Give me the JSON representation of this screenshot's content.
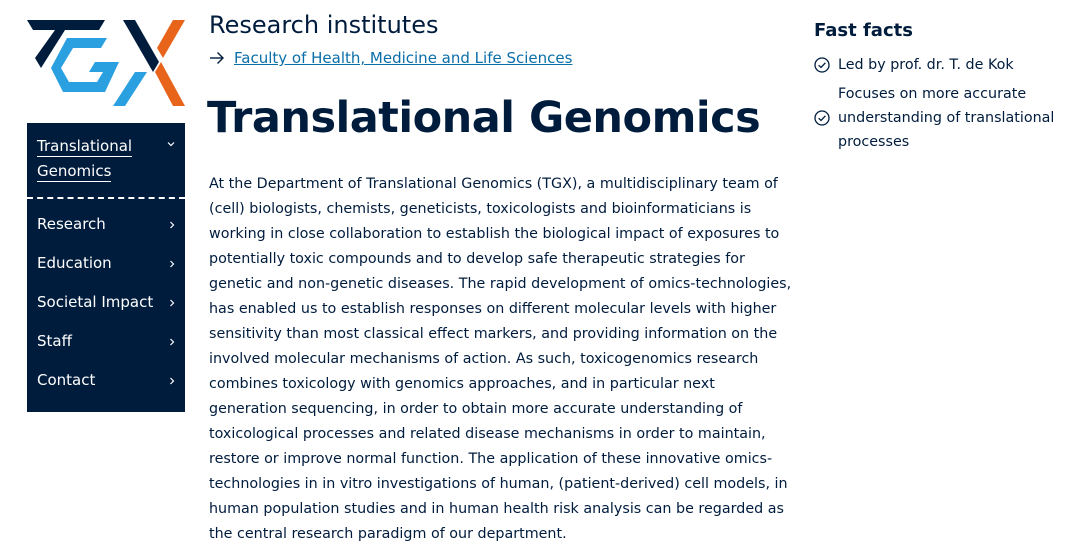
{
  "logo": {
    "name": "TGX"
  },
  "sidebar": {
    "active": {
      "label": "Translational Genomics"
    },
    "items": [
      {
        "label": "Research"
      },
      {
        "label": "Education"
      },
      {
        "label": "Societal Impact"
      },
      {
        "label": "Staff"
      },
      {
        "label": "Contact"
      }
    ]
  },
  "header": {
    "section_title": "Research institutes",
    "faculty_link": "Faculty of Health, Medicine and Life Sciences",
    "page_title": "Translational Genomics"
  },
  "main": {
    "intro": "At the Department of Translational Genomics (TGX), a multidisciplinary team of (cell) biologists, chemists, geneticists, toxicologists and bioinformaticians is working in close collaboration to establish the biological impact of exposures to potentially toxic compounds and to develop safe therapeutic strategies for genetic and non-genetic diseases. The rapid development of omics-technologies, has enabled us to establish responses on different molecular levels with higher sensitivity than most classical effect markers, and providing information on the involved molecular mechanisms of action. As such, toxicogenomics research combines toxicology with genomics approaches, and in particular next generation sequencing, in order to obtain more accurate understanding of toxicological processes and related disease mechanisms in order to maintain, restore or improve normal function. The application of these innovative omics-technologies in in vitro investigations of human, (patient-derived) cell models, in human population studies and in human health risk analysis can be regarded as the central research paradigm of our department."
  },
  "fast_facts": {
    "title": "Fast facts",
    "items": [
      {
        "text": "Led by prof. dr. T. de Kok"
      },
      {
        "text": "Focuses on more accurate understanding of translational processes"
      }
    ]
  },
  "colors": {
    "navy": "#001c3d",
    "link": "#0a6ea8",
    "logo_cyan": "#2aa0e0",
    "logo_orange": "#e8641b"
  }
}
